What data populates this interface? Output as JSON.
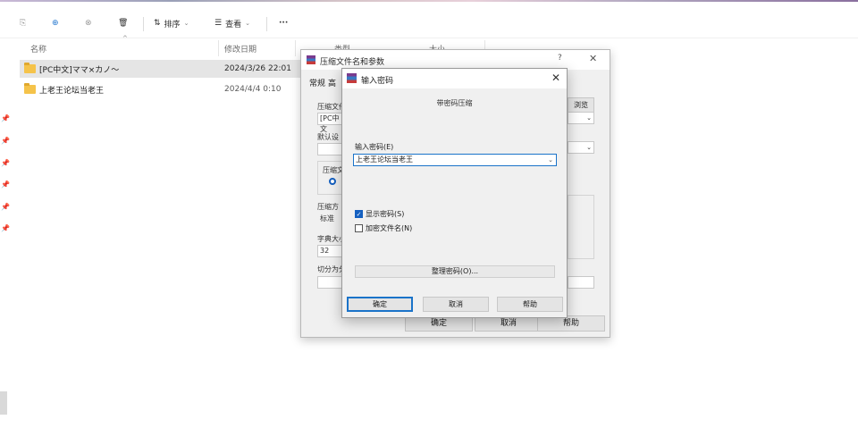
{
  "toolbar": {
    "sort_label": "排序",
    "view_label": "查看",
    "more_label": "···"
  },
  "columns": {
    "name": "名称",
    "modified": "修改日期",
    "type": "类型",
    "size": "大小"
  },
  "files": [
    {
      "name": "[PC中文]ママ×カノ～",
      "date": "2024/3/26 22:01"
    },
    {
      "name": "上老王论坛当老王",
      "date": "2024/4/4 0:10"
    }
  ],
  "archive_dialog": {
    "title": "压缩文件名和参数",
    "help": "?",
    "tab_general": "常规",
    "tab_second": "高",
    "label_archive_name": "压缩文件",
    "archive_name_value": "[PC中文",
    "browse_label": "浏览(B)...",
    "label_default": "默认设",
    "label_format": "压缩文",
    "label_method": "压缩方",
    "method_value": "标准",
    "label_dict": "字典大小",
    "dict_value": "32",
    "label_split": "切分为分",
    "ok": "确定",
    "cancel": "取消",
    "help_btn": "帮助"
  },
  "password_dialog": {
    "title": "输入密码",
    "subtitle": "带密码压缩",
    "input_label": "输入密码(E)",
    "password_value": "上老王论坛当老王",
    "show_password": "显示密码(S)",
    "show_password_checked": true,
    "encrypt_names": "加密文件名(N)",
    "encrypt_names_checked": false,
    "organize": "整理密码(O)...",
    "ok": "确定",
    "cancel": "取消",
    "help": "帮助"
  }
}
